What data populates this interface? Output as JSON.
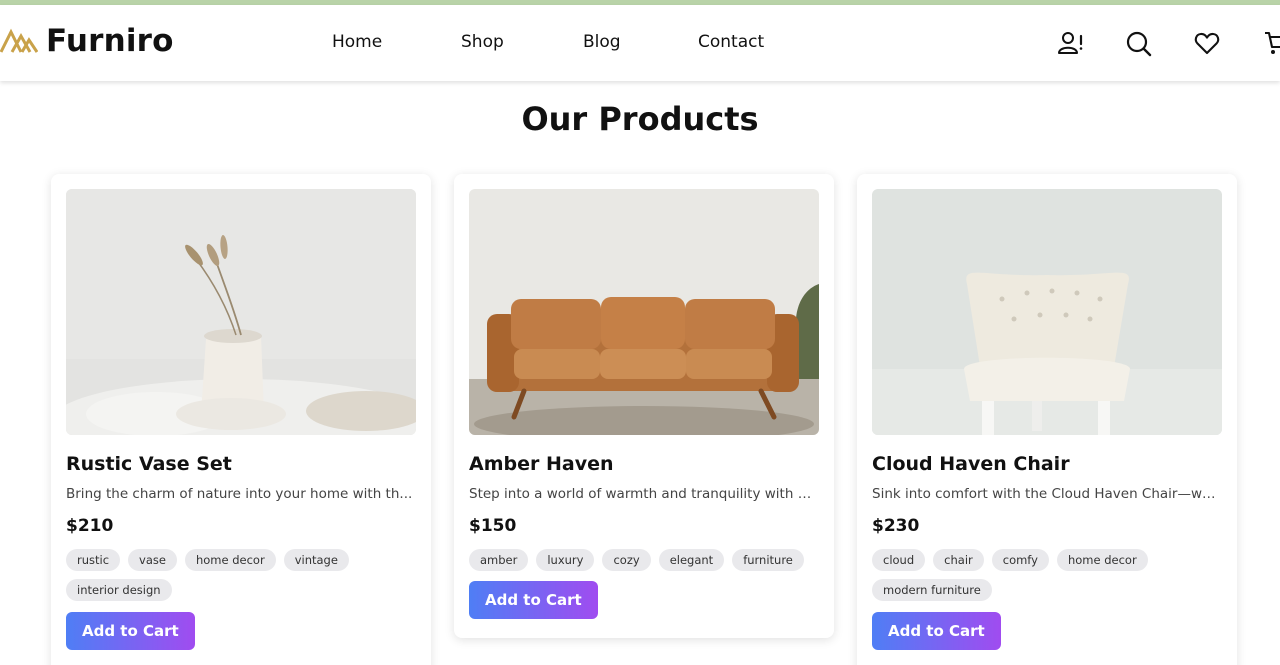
{
  "brand": {
    "name": "Furniro",
    "accent": "#c9a24a"
  },
  "nav": {
    "links": [
      {
        "label": "Home"
      },
      {
        "label": "Shop"
      },
      {
        "label": "Blog"
      },
      {
        "label": "Contact"
      }
    ],
    "icons": [
      "user-alert-icon",
      "search-icon",
      "heart-icon",
      "cart-icon"
    ]
  },
  "section": {
    "title": "Our Products"
  },
  "button_gradient": [
    "#4f7ef5",
    "#a04cf0"
  ],
  "products": [
    {
      "name": "Rustic Vase Set",
      "description": "Bring the charm of nature into your home with th...",
      "price": "$210",
      "tags": [
        "rustic",
        "vase",
        "home decor",
        "vintage",
        "interior design"
      ],
      "cta": "Add to Cart"
    },
    {
      "name": "Amber Haven",
      "description": "Step into a world of warmth and tranquility with A...",
      "price": "$150",
      "tags": [
        "amber",
        "luxury",
        "cozy",
        "elegant",
        "furniture"
      ],
      "cta": "Add to Cart"
    },
    {
      "name": "Cloud Haven Chair",
      "description": "Sink into comfort with the Cloud Haven Chair—wh...",
      "price": "$230",
      "tags": [
        "cloud",
        "chair",
        "comfy",
        "home decor",
        "modern furniture"
      ],
      "cta": "Add to Cart"
    }
  ]
}
